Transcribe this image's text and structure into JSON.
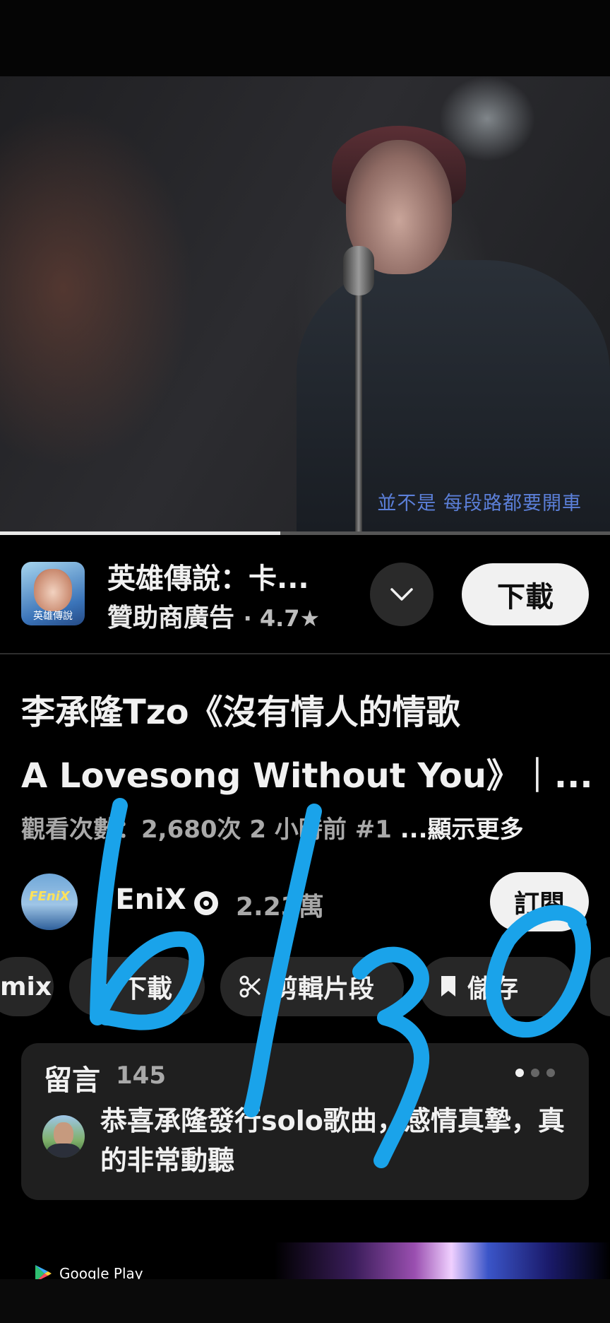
{
  "video": {
    "subtitle": "並不是 每段路都要開車",
    "progress_fraction": 0.46
  },
  "ad": {
    "app_icon_label": "英雄傳說",
    "title": "英雄傳說：卡...",
    "sponsor": "贊助商廣告",
    "rating": "· 4.7★",
    "download_label": "下載"
  },
  "video_info": {
    "title_line1": "李承隆Tzo《沒有情人的情歌",
    "title_line2": "A Lovesong Without You》｜...",
    "views": "觀看次數：2,680次",
    "age": "2 小時前",
    "hashtag": "#1",
    "show_more": "...顯示更多"
  },
  "channel": {
    "avatar_text": "FEniX",
    "name": "FEniX",
    "subscribers": "2.23萬",
    "subscribe_label": "訂閱"
  },
  "chips": {
    "remix": "mix",
    "download": "下載",
    "clip": "剪輯片段",
    "save": "儲存"
  },
  "comments": {
    "label": "留言",
    "count": "145",
    "top_comment": "恭喜承隆發行solo歌曲，感情真摯，真的非常動聽"
  },
  "bottom_ad": {
    "store": "Google Play"
  },
  "handwriting": "6/30",
  "colors": {
    "background": "#000000",
    "ink": "#1aa3ea",
    "subtitle": "#5b7fd8",
    "chip": "#272727",
    "button": "#f1f1f1"
  }
}
